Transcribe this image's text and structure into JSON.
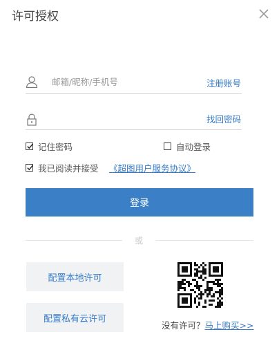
{
  "title": "许可授权",
  "account": {
    "placeholder": "邮箱/昵称/手机号",
    "register_link": "注册账号"
  },
  "password": {
    "placeholder": "",
    "forgot_link": "找回密码"
  },
  "options": {
    "remember_label": "记住密码",
    "remember_checked": true,
    "auto_login_label": "自动登录",
    "auto_login_checked": false,
    "agree_label": "我已阅读并接受",
    "agree_checked": true,
    "agree_link": "《超图用户服务协议》"
  },
  "login_button": "登录",
  "divider_text": "或",
  "local_license_button": "配置本地许可",
  "private_cloud_button": "配置私有云许可",
  "buy": {
    "prompt": "没有许可？",
    "link": "马上购买>>"
  },
  "colors": {
    "accent": "#3b7fc6",
    "link": "#3479c6",
    "secondary_button_bg": "#f1f2f4"
  },
  "icons": {
    "close": "close-icon",
    "user": "user-icon",
    "lock": "lock-icon",
    "checkmark": "checkmark-icon",
    "qr": "qr-code-icon"
  }
}
